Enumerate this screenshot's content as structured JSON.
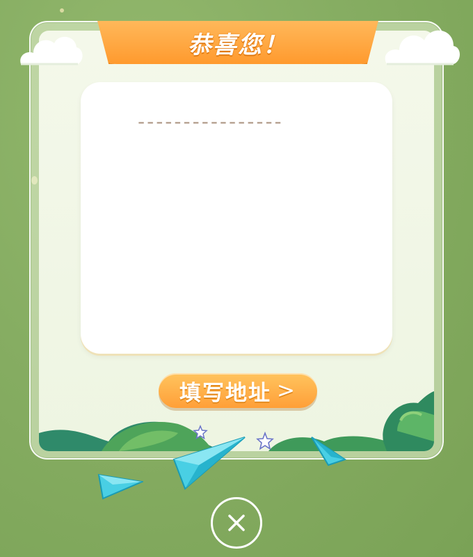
{
  "dialog": {
    "title": "恭喜您！",
    "prize_placeholder": "----------------",
    "address_button_label": "填写地址",
    "address_button_arrow": ">"
  },
  "icons": {
    "close": "close-icon",
    "clouds": "cloud-icon",
    "planes": "paper-plane-icon",
    "stars": "star-icon"
  },
  "colors": {
    "background": "#86ad62",
    "banner": "#ff9a2e",
    "button": "#ffb34c",
    "dash": "#b09a88",
    "plane": "#3cc6dd"
  }
}
